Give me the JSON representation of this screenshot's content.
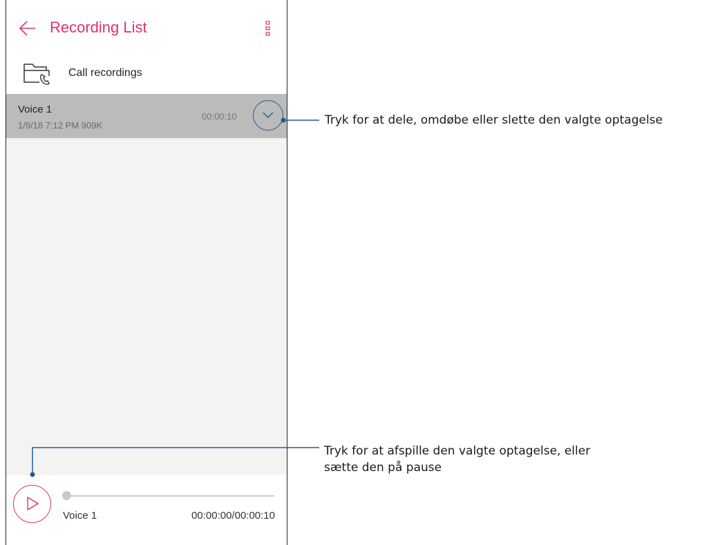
{
  "app_bar": {
    "title": "Recording List",
    "back_icon": "arrow-left-icon",
    "menu_icon": "vertical-dots-icon"
  },
  "folder": {
    "label": "Call recordings",
    "icon": "folder-phone-icon"
  },
  "recordings": [
    {
      "name": "Voice 1",
      "meta": "1/9/18 7:12 PM   909K",
      "duration": "00:00:10"
    }
  ],
  "player": {
    "track_name": "Voice 1",
    "time": "00:00:00/00:00:10",
    "progress": 0
  },
  "callouts": {
    "expand_hint": "Tryk for at dele, omdøbe eller slette den valgte optagelse",
    "play_hint_line1": "Tryk for at afspille den valgte optagelse, eller",
    "play_hint_line2": "sætte den på pause"
  },
  "colors": {
    "accent": "#e0306a",
    "callout_line": "#1f5c8f",
    "selected_row": "#bbbbbb",
    "list_background": "#f3f3f3"
  }
}
